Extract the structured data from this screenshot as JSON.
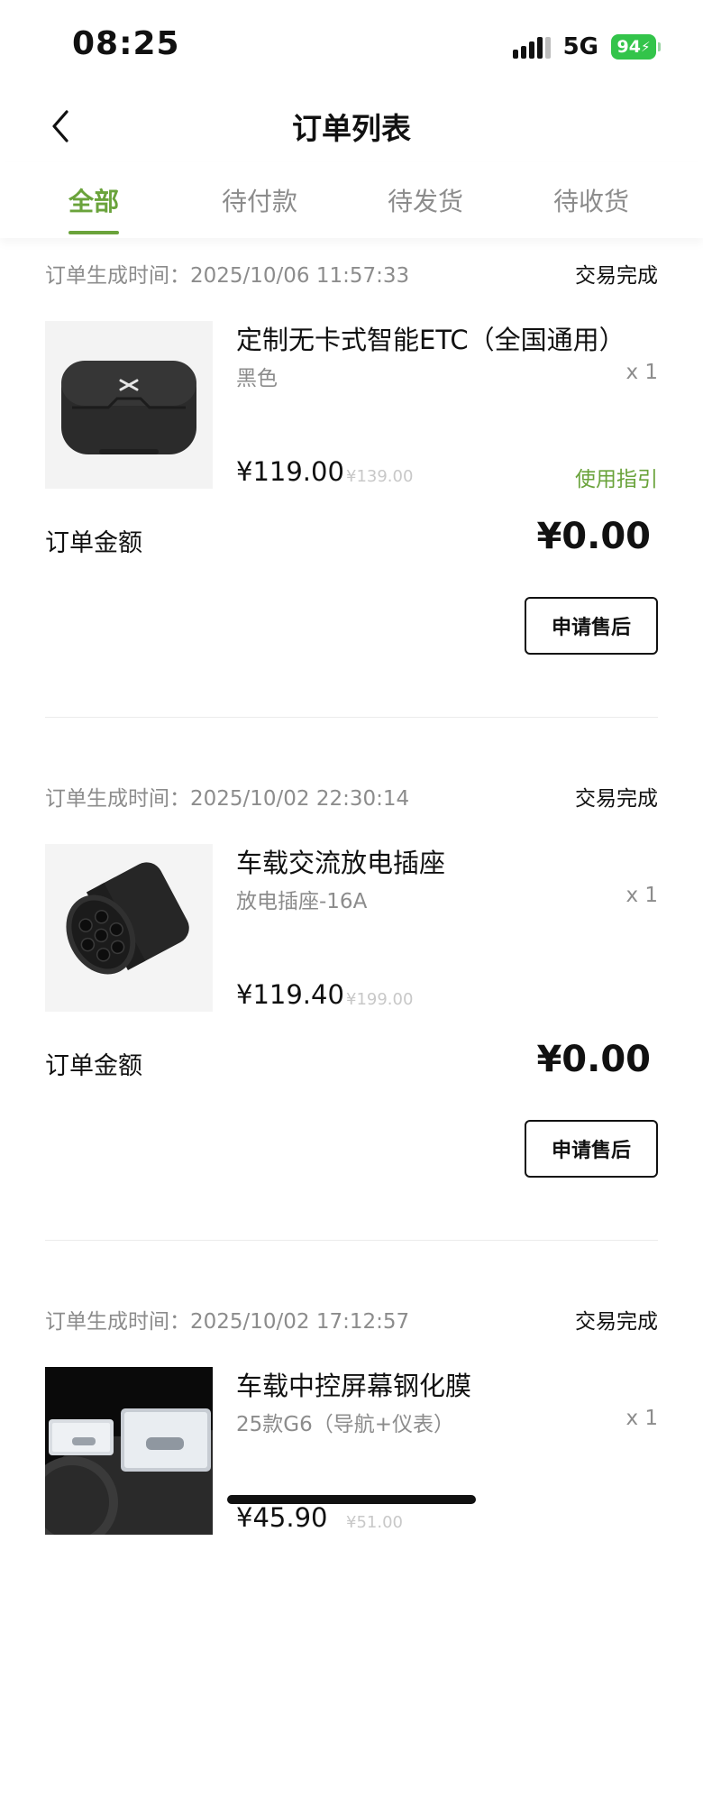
{
  "status_bar": {
    "time": "08:25",
    "network": "5G",
    "battery": "94"
  },
  "header": {
    "title": "订单列表"
  },
  "tabs": [
    {
      "label": "全部",
      "active": true
    },
    {
      "label": "待付款",
      "active": false
    },
    {
      "label": "待发货",
      "active": false
    },
    {
      "label": "待收货",
      "active": false
    }
  ],
  "colors": {
    "accent": "#6aa33b",
    "battery": "#33c44a"
  },
  "orders": [
    {
      "time_label": "订单生成时间：",
      "time": "2025/10/06 11:57:33",
      "status": "交易完成",
      "product_name": "定制无卡式智能ETC（全国通用）",
      "variant": "黑色",
      "qty": "x 1",
      "price": "¥119.00",
      "original_price": "¥139.00",
      "guide_link": "使用指引",
      "total_label": "订单金额",
      "total": "¥0.00",
      "button": "申请售后",
      "thumb_icon": "etc-device-icon"
    },
    {
      "time_label": "订单生成时间：",
      "time": "2025/10/02 22:30:14",
      "status": "交易完成",
      "product_name": "车载交流放电插座",
      "variant": "放电插座-16A",
      "qty": "x 1",
      "price": "¥119.40",
      "original_price": "¥199.00",
      "total_label": "订单金额",
      "total": "¥0.00",
      "button": "申请售后",
      "thumb_icon": "discharge-socket-icon"
    },
    {
      "time_label": "订单生成时间：",
      "time": "2025/10/02 17:12:57",
      "status": "交易完成",
      "product_name": "车载中控屏幕钢化膜",
      "variant": "25款G6（导航+仪表）",
      "qty": "x 1",
      "price": "¥45.90",
      "original_price": "¥51.00",
      "thumb_icon": "screen-protector-icon"
    }
  ]
}
